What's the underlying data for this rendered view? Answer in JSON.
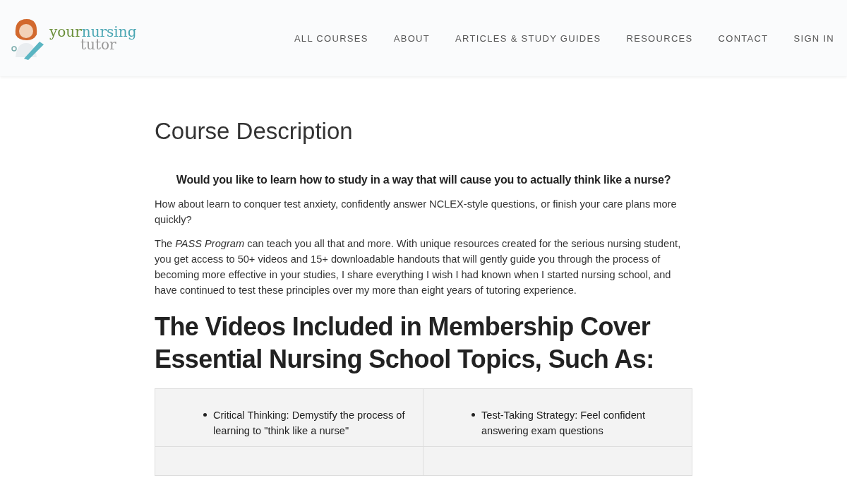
{
  "logo": {
    "word_1": "your",
    "word_2": "nursing",
    "word_3": "tutor"
  },
  "nav": [
    {
      "label": "ALL COURSES"
    },
    {
      "label": "ABOUT"
    },
    {
      "label": "ARTICLES & STUDY GUIDES"
    },
    {
      "label": "RESOURCES"
    },
    {
      "label": "CONTACT"
    },
    {
      "label": "SIGN IN"
    }
  ],
  "title": "Course Description",
  "lead": "Would you like to learn how to study in a way that will cause you to actually think like a nurse?",
  "paragraphs": [
    "How about learn to conquer test anxiety, confidently answer NCLEX-style questions, or finish your care plans more quickly?",
    "The *PASS Program* can teach you all that and more. With unique resources created for the serious nursing student, you get access to 50+ videos and 15+ downloadable handouts that will gently guide you through the process of becoming more effective in your studies, I share everything I wish I had known when I started nursing school, and have continued to test these principles over my more than eight years of tutoring experience."
  ],
  "heading": "The Videos Included in Membership Cover Essential Nursing School Topics, Such As:",
  "topics": [
    [
      "Critical Thinking: Demystify the process of learning to \"think like a nurse\"",
      "Test-Taking Strategy: Feel confident answering exam questions"
    ]
  ]
}
